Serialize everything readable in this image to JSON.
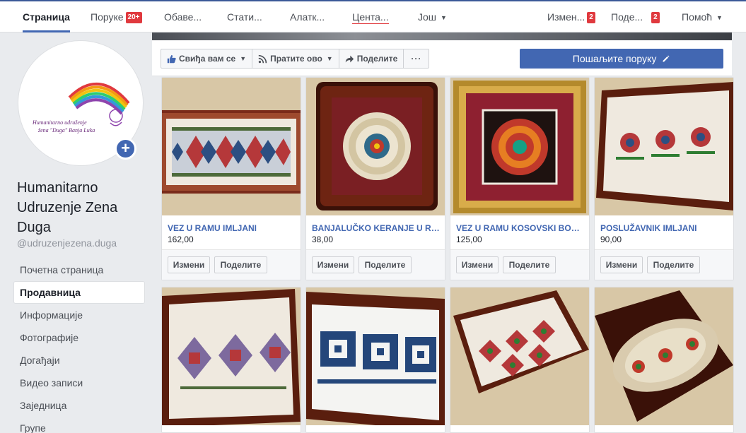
{
  "topnav": {
    "items": [
      {
        "label": "Страница"
      },
      {
        "label": "Поруке",
        "badge": "20+"
      },
      {
        "label": "Обаве..."
      },
      {
        "label": "Стати..."
      },
      {
        "label": "Алатк..."
      },
      {
        "label": "Цента..."
      },
      {
        "label": "Још"
      },
      {
        "label": "Измен...",
        "badge": "2"
      },
      {
        "label": "Поде...",
        "badge": "2"
      },
      {
        "label": "Помоћ"
      }
    ]
  },
  "page": {
    "logo_text_line1": "Humanitarno udruženje",
    "logo_text_line2": "žena \"Duga\" Banja Luka",
    "name": "Humanitarno Udruzenje Zena Duga",
    "handle": "@udruzenjezena.duga"
  },
  "sidebar": {
    "items": [
      {
        "label": "Почетна страница"
      },
      {
        "label": "Продавница"
      },
      {
        "label": "Информације"
      },
      {
        "label": "Фотографије"
      },
      {
        "label": "Догађаји"
      },
      {
        "label": "Видео записи"
      },
      {
        "label": "Заједница"
      },
      {
        "label": "Групе"
      }
    ]
  },
  "actions": {
    "like": "Свиђа вам се",
    "follow": "Пратите ово",
    "share": "Поделите",
    "more": "···",
    "message": "Пошаљите поруку"
  },
  "products": [
    {
      "name": "VEZ U RAMU IMLJANI",
      "price": "162,00",
      "edit": "Измени",
      "share": "Поделите"
    },
    {
      "name": "BANJALUČKO KERANJE U RA...",
      "price": "38,00",
      "edit": "Измени",
      "share": "Поделите"
    },
    {
      "name": "VEZ U RAMU KOSOVSKI BOŽUR",
      "price": "125,00",
      "edit": "Измени",
      "share": "Поделите"
    },
    {
      "name": "POSLUŽAVNIK IMLJANI",
      "price": "90,00",
      "edit": "Измени",
      "share": "Поделите"
    }
  ],
  "colors": {
    "brand": "#4267b2",
    "badge": "#e0393e",
    "background": "#e9ebee"
  }
}
